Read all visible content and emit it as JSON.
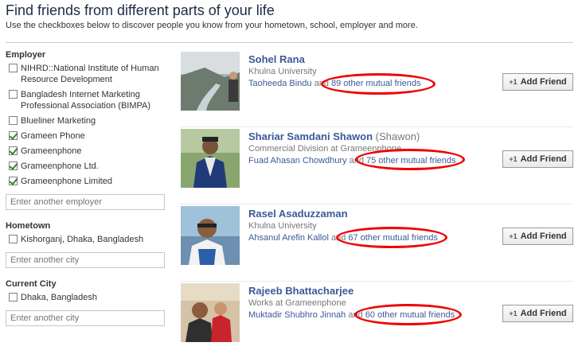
{
  "header": {
    "title": "Find friends from different parts of your life",
    "subtitle": "Use the checkboxes below to discover people you know from your hometown, school, employer and more."
  },
  "sidebar": {
    "employer": {
      "title": "Employer",
      "items": [
        {
          "label": "NIHRD::National Institute of Human Resource Development",
          "checked": false
        },
        {
          "label": "Bangladesh Internet Marketing Professional Association (BIMPA)",
          "checked": false
        },
        {
          "label": "Blueliner Marketing",
          "checked": false
        },
        {
          "label": "Grameen Phone",
          "checked": true
        },
        {
          "label": "Grameenphone",
          "checked": true
        },
        {
          "label": "Grameenphone Ltd.",
          "checked": true
        },
        {
          "label": "Grameenphone Limited",
          "checked": true
        }
      ],
      "placeholder": "Enter another employer"
    },
    "hometown": {
      "title": "Hometown",
      "items": [
        {
          "label": "Kishorganj, Dhaka, Bangladesh",
          "checked": false
        }
      ],
      "placeholder": "Enter another city"
    },
    "current_city": {
      "title": "Current City",
      "items": [
        {
          "label": "Dhaka, Bangladesh",
          "checked": false
        }
      ],
      "placeholder": "Enter another city"
    }
  },
  "people": [
    {
      "name": "Sohel Rana",
      "alias": "",
      "sub": "Khulna University",
      "mutual_friend": "Taoheeda Bindu",
      "and": "and",
      "mutual_count": "89 other mutual friends",
      "button": "Add Friend"
    },
    {
      "name": "Shariar Samdani Shawon",
      "alias": "(Shawon)",
      "sub": "Commercial Division at Grameenphone",
      "mutual_friend": "Fuad Ahasan Chowdhury",
      "and": "and",
      "mutual_count": "75 other mutual friends",
      "button": "Add Friend"
    },
    {
      "name": "Rasel Asaduzzaman",
      "alias": "",
      "sub": "Khulna University",
      "mutual_friend": "Ahsanul Arefin Kallol",
      "and": "and",
      "mutual_count": "67 other mutual friends",
      "button": "Add Friend"
    },
    {
      "name": "Rajeeb Bhattacharjee",
      "alias": "",
      "sub": "Works at Grameenphone",
      "mutual_friend": "Muktadir Shubhro Jinnah",
      "and": "and",
      "mutual_count": "60 other mutual friends",
      "button": "Add Friend"
    }
  ],
  "icons": {
    "add_friend": "plus-one-icon",
    "checkbox_checked": "checkmark-icon"
  }
}
